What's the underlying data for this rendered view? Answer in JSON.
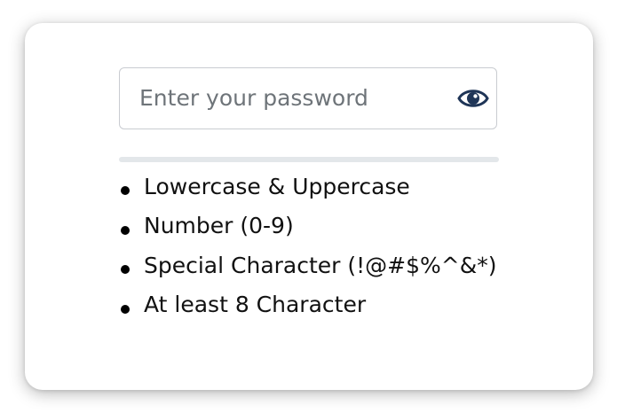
{
  "password": {
    "placeholder": "Enter your password",
    "value": "",
    "visibility_icon": "eye-icon"
  },
  "strength": {
    "progress": 0
  },
  "requirements": [
    {
      "label": "Lowercase & Uppercase",
      "met": false
    },
    {
      "label": "Number (0-9)",
      "met": false
    },
    {
      "label": "Special Character (!@#$%^&*)",
      "met": false
    },
    {
      "label": "At least 8 Character",
      "met": false
    }
  ],
  "colors": {
    "icon": "#1f3557",
    "bar_track": "#e3e7ea",
    "border": "#c9ccd1"
  }
}
